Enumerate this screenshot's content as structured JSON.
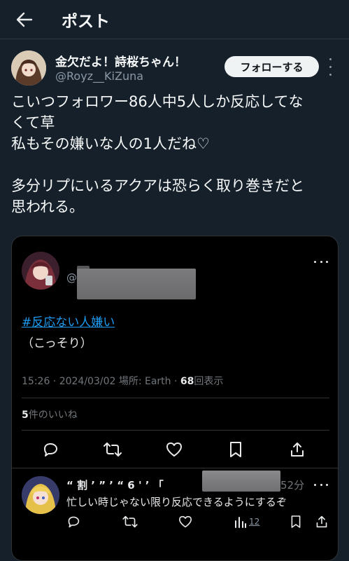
{
  "header": {
    "title": "ポスト",
    "back_icon": "arrow-left-icon"
  },
  "author": {
    "name": "金欠だよ！詩桜ちゃん！",
    "handle": "@Royz__KiZuna",
    "follow_label": "フォローする"
  },
  "post": {
    "lines": [
      "こいつフォロワー86人中5人しか反応してな",
      "くて草",
      "私もその嫌いな人の1人だね♡",
      "",
      "多分リプにいるアクアは恐らく取り巻きだと",
      "思われる。"
    ]
  },
  "quoted": {
    "at_symbol": "@",
    "hashtag": "#反応ない人嫌い",
    "body": "（こっそり）",
    "meta_time": "15:26 · 2024/03/02 場所: Earth · ",
    "views_count": "68",
    "views_label": "回表示",
    "likes_count": "5",
    "likes_label": "件のいいね",
    "reply": {
      "name_fragment": "“ 割 ’ ” ’ “ 6 ' ’ 「",
      "time": "52分",
      "text": "忙しい時じゃない限り反応できるようにするぞ",
      "views_count": "12"
    }
  },
  "colors": {
    "background": "#15202b",
    "quote_background": "#000000",
    "link": "#1d9bf0",
    "muted": "#71767b"
  }
}
